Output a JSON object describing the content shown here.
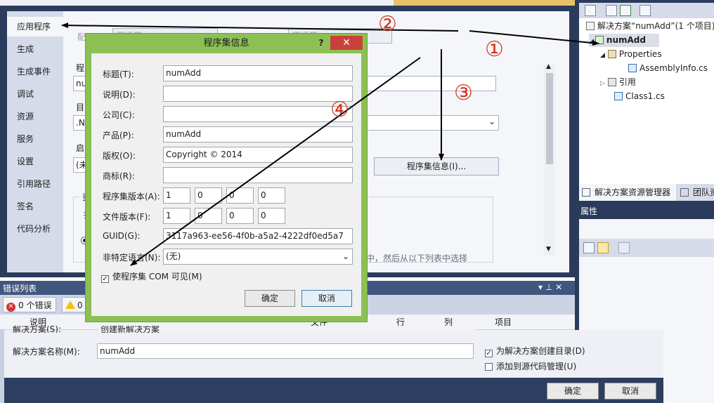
{
  "project_properties": {
    "tabs": [
      "应用程序",
      "生成",
      "生成事件",
      "调试",
      "资源",
      "服务",
      "设置",
      "引用路径",
      "签名",
      "代码分析"
    ],
    "fragments": {
      "config_label": "配置(",
      "config_value": "不适用",
      "platform_label": "平台(M",
      "platform_value": "不适用",
      "assembly_name_cut": "程",
      "assembly_value_cut": "nu",
      "target_cut": "目",
      "target_value_cut": ".N",
      "startup_cut": "启",
      "startup_value_cut": "(未",
      "resource_cut": "资",
      "icon_cut": "推",
      "bottom_tail": "中，然后从以下列表中选择"
    },
    "assembly_info_button": "程序集信息(I)..."
  },
  "dialog": {
    "title": "程序集信息",
    "help": "?",
    "close": "✕",
    "labels": {
      "title": "标题(T):",
      "description": "说明(D):",
      "company": "公司(C):",
      "product": "产品(P):",
      "copyright": "版权(O):",
      "trademark": "商标(R):",
      "assembly_version": "程序集版本(A):",
      "file_version": "文件版本(F):",
      "guid": "GUID(G):",
      "neutral_language": "非特定语言(N):"
    },
    "values": {
      "title": "numAdd",
      "description": "",
      "company": "",
      "product": "numAdd",
      "copyright": "Copyright ©  2014",
      "trademark": "",
      "assembly_version": [
        "1",
        "0",
        "0",
        "0"
      ],
      "file_version": [
        "1",
        "0",
        "0",
        "0"
      ],
      "guid": "3117a963-ee56-4f0b-a5a2-4222df0ed5a7",
      "neutral_language": "(无)"
    },
    "com_visible_label": "使程序集 COM 可见(M)",
    "com_visible_checked": true,
    "ok": "确定",
    "cancel": "取消"
  },
  "solution_explorer": {
    "items": [
      "解决方案“numAdd”(1 个项目)",
      "numAdd",
      "Properties",
      "AssemblyInfo.cs",
      "引用",
      "Class1.cs"
    ],
    "tabs": [
      "解决方案资源管理器",
      "团队资"
    ],
    "properties_title": "属性"
  },
  "error_list": {
    "title": "错误列表",
    "title_controls": "▾ ⊥ ✕",
    "errors": "0 个错误",
    "warnings": "0",
    "columns": [
      "说明",
      "文件",
      "行",
      "列",
      "项目"
    ]
  },
  "new_project": {
    "solution_label_cut": "解决方案(S):",
    "solution_value_cut": "创建新解决方案",
    "solution_name_label": "解决方案名称(M):",
    "solution_name_value": "numAdd",
    "create_dir_label": "为解决方案创建目录(D)",
    "create_dir_checked": true,
    "source_control_label": "添加到源代码管理(U)",
    "source_control_checked": false,
    "ok": "确定",
    "cancel": "取消"
  },
  "annotations": [
    "②",
    "①",
    "③",
    "④"
  ],
  "colors": {
    "accent_green": "#8cc055",
    "annotation_red": "#d3331b",
    "chrome_dark": "#2b3b5c"
  }
}
